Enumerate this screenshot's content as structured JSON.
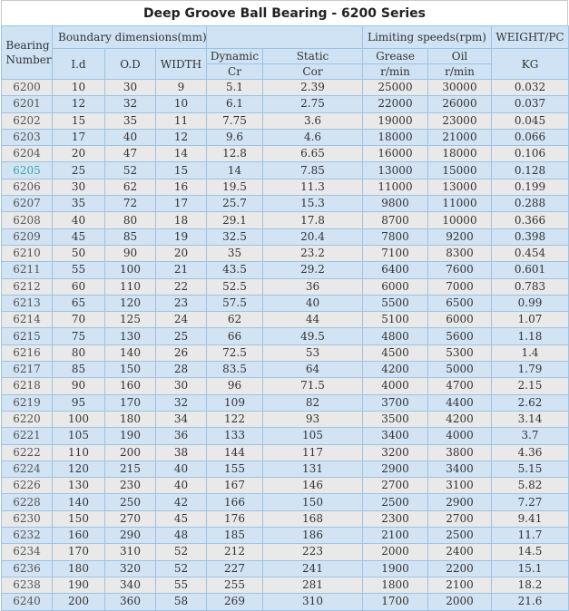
{
  "title": "Deep Groove Ball Bearing - 6200 Series",
  "headers": {
    "bearing_number": "Bearing Number",
    "boundary": "Boundary dimensions(mm)",
    "id": "I.d",
    "od": "O.D",
    "width": "WIDTH",
    "dynamic": "Dynamic",
    "dynamic_sub": "Cr",
    "static": "Static",
    "static_sub": "Cor",
    "limiting": "Limiting speeds(rpm)",
    "grease": "Grease",
    "grease_sub": "r/min",
    "oil": "Oil",
    "oil_sub": "r/min",
    "weight": "WEIGHT/PC",
    "weight_sub": "KG"
  },
  "rows": [
    [
      "6200",
      "10",
      "30",
      "9",
      "5.1",
      "2.39",
      "25000",
      "30000",
      "0.032"
    ],
    [
      "6201",
      "12",
      "32",
      "10",
      "6.1",
      "2.75",
      "22000",
      "26000",
      "0.037"
    ],
    [
      "6202",
      "15",
      "35",
      "11",
      "7.75",
      "3.6",
      "19000",
      "23000",
      "0.045"
    ],
    [
      "6203",
      "17",
      "40",
      "12",
      "9.6",
      "4.6",
      "18000",
      "21000",
      "0.066"
    ],
    [
      "6204",
      "20",
      "47",
      "14",
      "12.8",
      "6.65",
      "16000",
      "18000",
      "0.106"
    ],
    [
      "6205",
      "25",
      "52",
      "15",
      "14",
      "7.85",
      "13000",
      "15000",
      "0.128"
    ],
    [
      "6206",
      "30",
      "62",
      "16",
      "19.5",
      "11.3",
      "11000",
      "13000",
      "0.199"
    ],
    [
      "6207",
      "35",
      "72",
      "17",
      "25.7",
      "15.3",
      "9800",
      "11000",
      "0.288"
    ],
    [
      "6208",
      "40",
      "80",
      "18",
      "29.1",
      "17.8",
      "8700",
      "10000",
      "0.366"
    ],
    [
      "6209",
      "45",
      "85",
      "19",
      "32.5",
      "20.4",
      "7800",
      "9200",
      "0.398"
    ],
    [
      "6210",
      "50",
      "90",
      "20",
      "35",
      "23.2",
      "7100",
      "8300",
      "0.454"
    ],
    [
      "6211",
      "55",
      "100",
      "21",
      "43.5",
      "29.2",
      "6400",
      "7600",
      "0.601"
    ],
    [
      "6212",
      "60",
      "110",
      "22",
      "52.5",
      "36",
      "6000",
      "7000",
      "0.783"
    ],
    [
      "6213",
      "65",
      "120",
      "23",
      "57.5",
      "40",
      "5500",
      "6500",
      "0.99"
    ],
    [
      "6214",
      "70",
      "125",
      "24",
      "62",
      "44",
      "5100",
      "6000",
      "1.07"
    ],
    [
      "6215",
      "75",
      "130",
      "25",
      "66",
      "49.5",
      "4800",
      "5600",
      "1.18"
    ],
    [
      "6216",
      "80",
      "140",
      "26",
      "72.5",
      "53",
      "4500",
      "5300",
      "1.4"
    ],
    [
      "6217",
      "85",
      "150",
      "28",
      "83.5",
      "64",
      "4200",
      "5000",
      "1.79"
    ],
    [
      "6218",
      "90",
      "160",
      "30",
      "96",
      "71.5",
      "4000",
      "4700",
      "2.15"
    ],
    [
      "6219",
      "95",
      "170",
      "32",
      "109",
      "82",
      "3700",
      "4400",
      "2.62"
    ],
    [
      "6220",
      "100",
      "180",
      "34",
      "122",
      "93",
      "3500",
      "4200",
      "3.14"
    ],
    [
      "6221",
      "105",
      "190",
      "36",
      "133",
      "105",
      "3400",
      "4000",
      "3.7"
    ],
    [
      "6222",
      "110",
      "200",
      "38",
      "144",
      "117",
      "3200",
      "3800",
      "4.36"
    ],
    [
      "6224",
      "120",
      "215",
      "40",
      "155",
      "131",
      "2900",
      "3400",
      "5.15"
    ],
    [
      "6226",
      "130",
      "230",
      "40",
      "167",
      "146",
      "2700",
      "3100",
      "5.82"
    ],
    [
      "6228",
      "140",
      "250",
      "42",
      "166",
      "150",
      "2500",
      "2900",
      "7.27"
    ],
    [
      "6230",
      "150",
      "270",
      "45",
      "176",
      "168",
      "2300",
      "2700",
      "9.41"
    ],
    [
      "6232",
      "160",
      "290",
      "48",
      "185",
      "186",
      "2100",
      "2500",
      "11.7"
    ],
    [
      "6234",
      "170",
      "310",
      "52",
      "212",
      "223",
      "2000",
      "2400",
      "14.5"
    ],
    [
      "6236",
      "180",
      "320",
      "52",
      "227",
      "241",
      "1900",
      "2200",
      "15.1"
    ],
    [
      "6238",
      "190",
      "340",
      "55",
      "255",
      "281",
      "1800",
      "2100",
      "18.2"
    ],
    [
      "6240",
      "200",
      "360",
      "58",
      "269",
      "310",
      "1700",
      "2000",
      "21.6"
    ]
  ],
  "highlight_color": "#3aa6a6"
}
